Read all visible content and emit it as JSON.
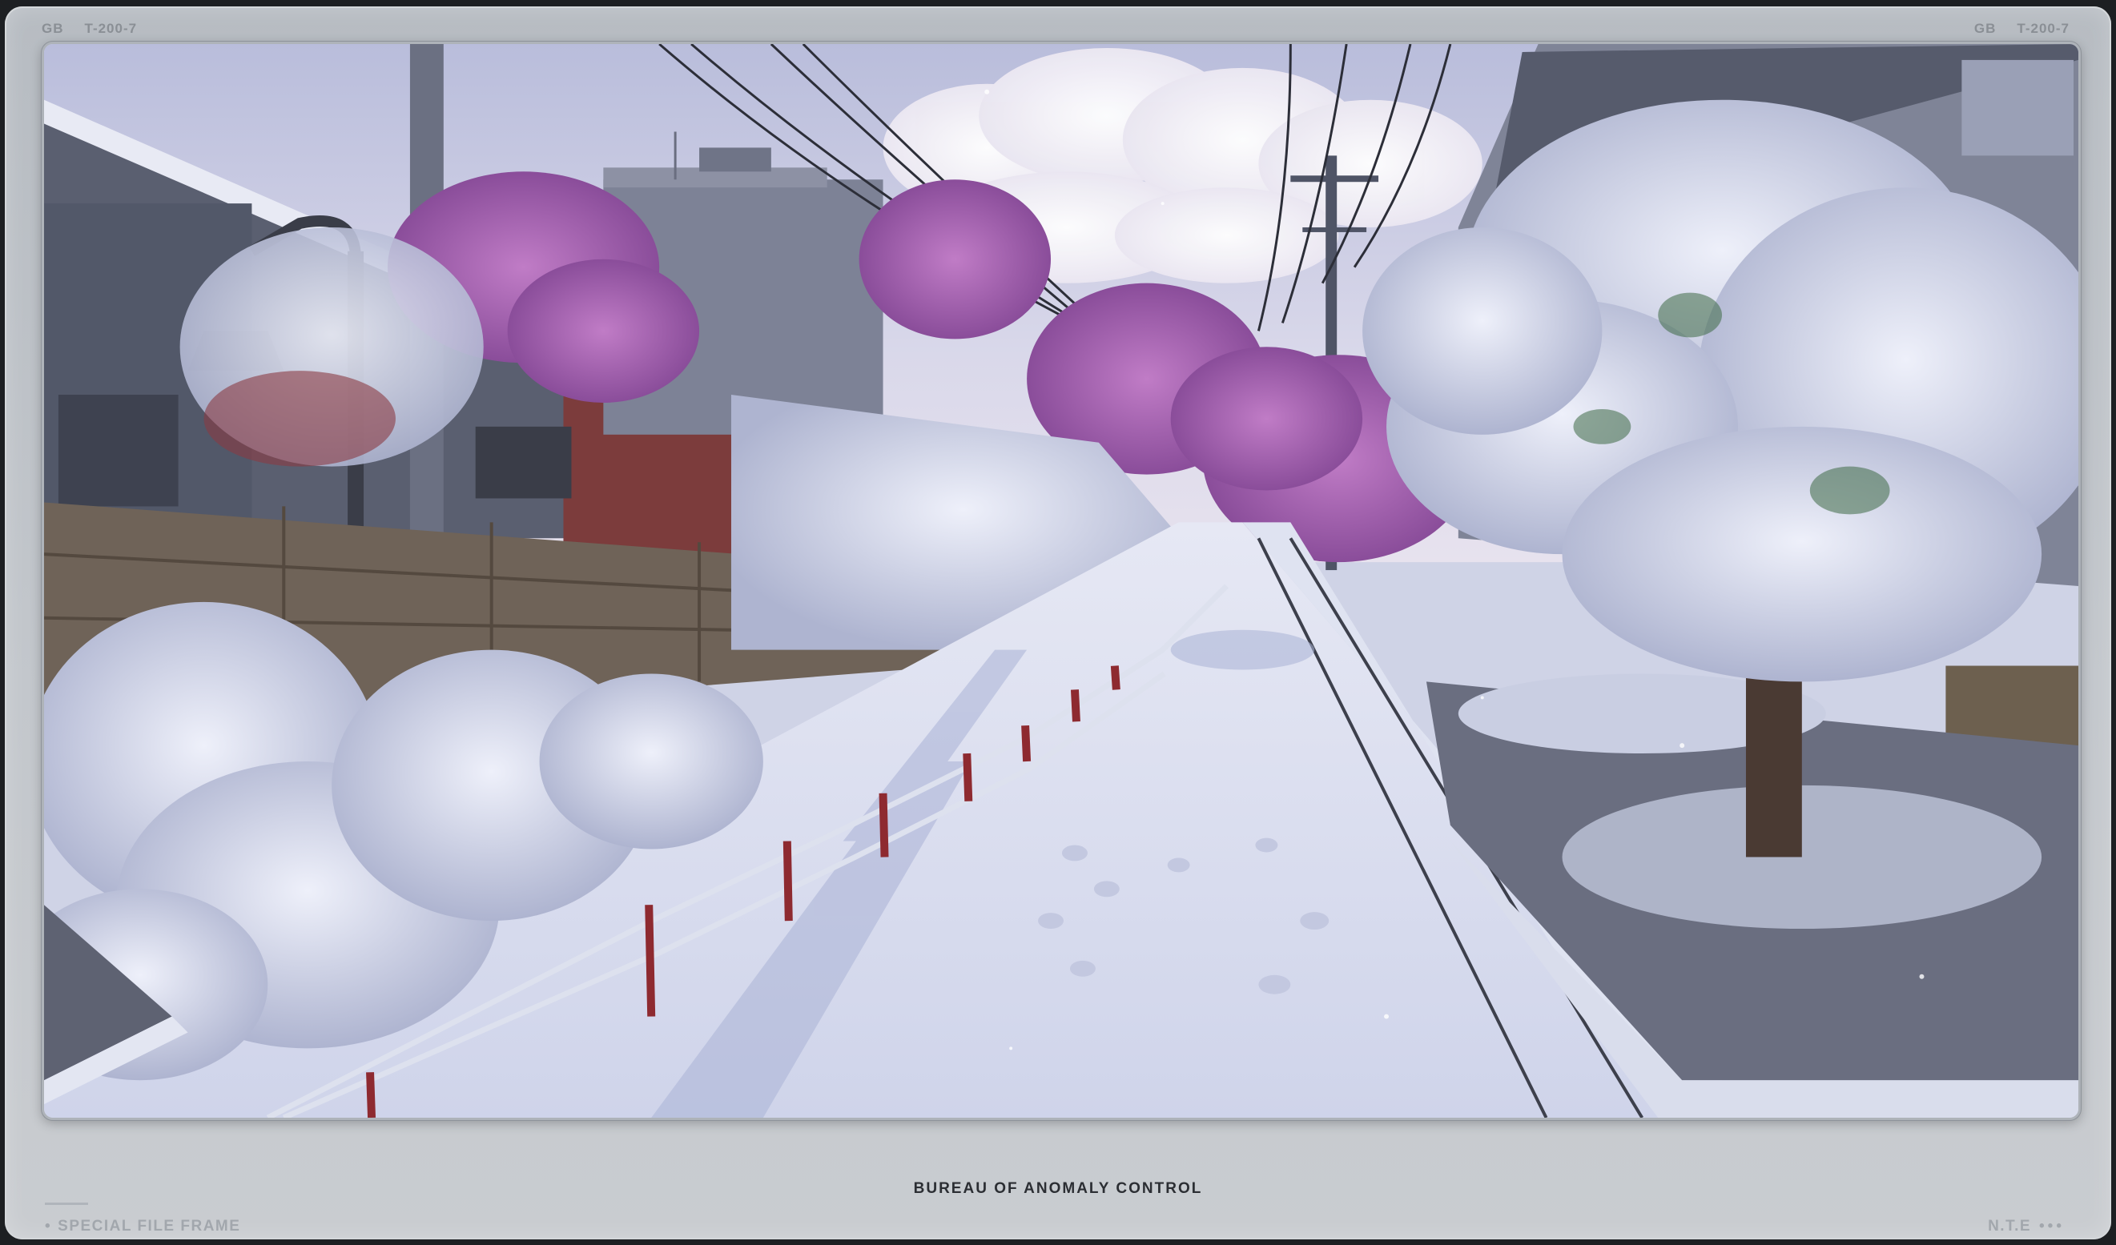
{
  "corners": {
    "left": {
      "code": "GB",
      "serial": "T-200-7"
    },
    "right": {
      "code": "GB",
      "serial": "T-200-7"
    }
  },
  "footer": {
    "title": "BUREAU OF ANOMALY CONTROL",
    "left_label": "SPECIAL FILE FRAME",
    "left_bullet": "•",
    "right_label": "N.T.E",
    "right_dots": "•••"
  },
  "colors": {
    "frame": "#c3c7cc",
    "snow": "#e9ecf6",
    "blossom_pink": "#b06ab8",
    "blossom_white": "#dfe3f2",
    "sky": "#cdd0e6",
    "rail_red": "#8e2a30"
  }
}
